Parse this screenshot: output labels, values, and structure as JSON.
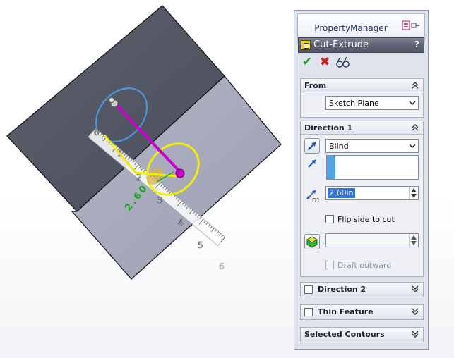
{
  "viewport": {
    "ruler_labels": [
      "0",
      "1",
      "2",
      "3",
      "4",
      "5",
      "6"
    ],
    "dimension_label": "2.60",
    "colors": {
      "top_face": "#585c68",
      "bottom_face": "#a8abbc",
      "edge": "#111111",
      "sketch_circle_blue": "#4a9ae6",
      "sketch_circle_yellow": "#f2ef00",
      "direction_arrow": "#cc00cc",
      "dimension_text": "#1aa81a"
    }
  },
  "property_manager": {
    "tab_label": "PropertyManager",
    "feature_title": "Cut-Extrude",
    "help_label": "?",
    "actions": {
      "ok_label": "✔",
      "cancel_label": "✖"
    },
    "from": {
      "title": "From",
      "selected": "Sketch Plane"
    },
    "direction1": {
      "title": "Direction 1",
      "end_condition": "Blind",
      "depth": "2.60in",
      "depth_badge": "D1",
      "flip_side_label": "Flip side to cut",
      "draft_label": "Draft outward"
    },
    "direction2": {
      "title": "Direction 2"
    },
    "thin_feature": {
      "title": "Thin Feature"
    },
    "selected_contours": {
      "title": "Selected Contours"
    }
  }
}
